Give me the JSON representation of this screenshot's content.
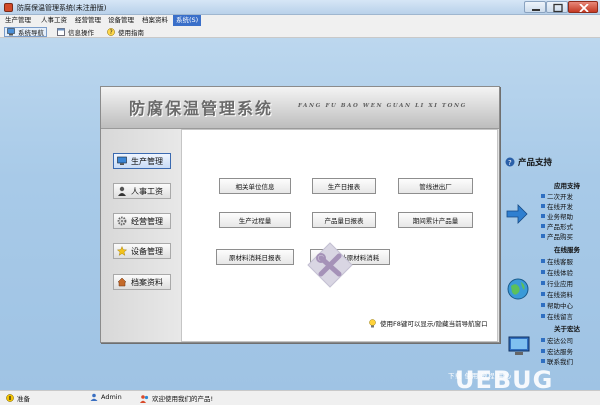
{
  "window": {
    "title": "防腐保温管理系统(未注册版)"
  },
  "menu": {
    "items": [
      "生产管理",
      "人事工资",
      "经营管理",
      "设备管理",
      "档案资料",
      "系统(S)"
    ]
  },
  "toolbar": {
    "items": [
      "系统导航",
      "信息操作",
      "使用指南"
    ]
  },
  "nav": {
    "title": "防腐保温管理系统",
    "pinyin": "FANG FU BAO WEN GUAN LI XI TONG",
    "categories": [
      "生产管理",
      "人事工资",
      "经营管理",
      "设备管理",
      "档案资料"
    ],
    "functions": [
      "相关单位信息",
      "生产日报表",
      "管线进出厂",
      "生产过程量",
      "产品量日报表",
      "期间累计产品量",
      "原材料消耗日报表",
      "期间累计原材料消耗"
    ],
    "hint": "使用F8键可以显示/隐藏当前导航窗口"
  },
  "support": {
    "title": "产品支持",
    "sections": [
      {
        "name": "应用支持",
        "links": [
          "二次开发",
          "在线开发",
          "业务帮助",
          "产品形式",
          "产品购买"
        ]
      },
      {
        "name": "在线服务",
        "links": [
          "在线客服",
          "在线体验",
          "行业应用",
          "在线资料",
          "帮助中心",
          "在线留言"
        ]
      },
      {
        "name": "关于宏达",
        "links": [
          "宏达公司",
          "宏达服务",
          "联系我们"
        ]
      }
    ]
  },
  "status": {
    "state": "准备",
    "user": "Admin",
    "message": "欢迎使用我们的产品!"
  },
  "watermark": {
    "text": "下载 使用 教程 中心",
    "logo": "UEBUG"
  }
}
